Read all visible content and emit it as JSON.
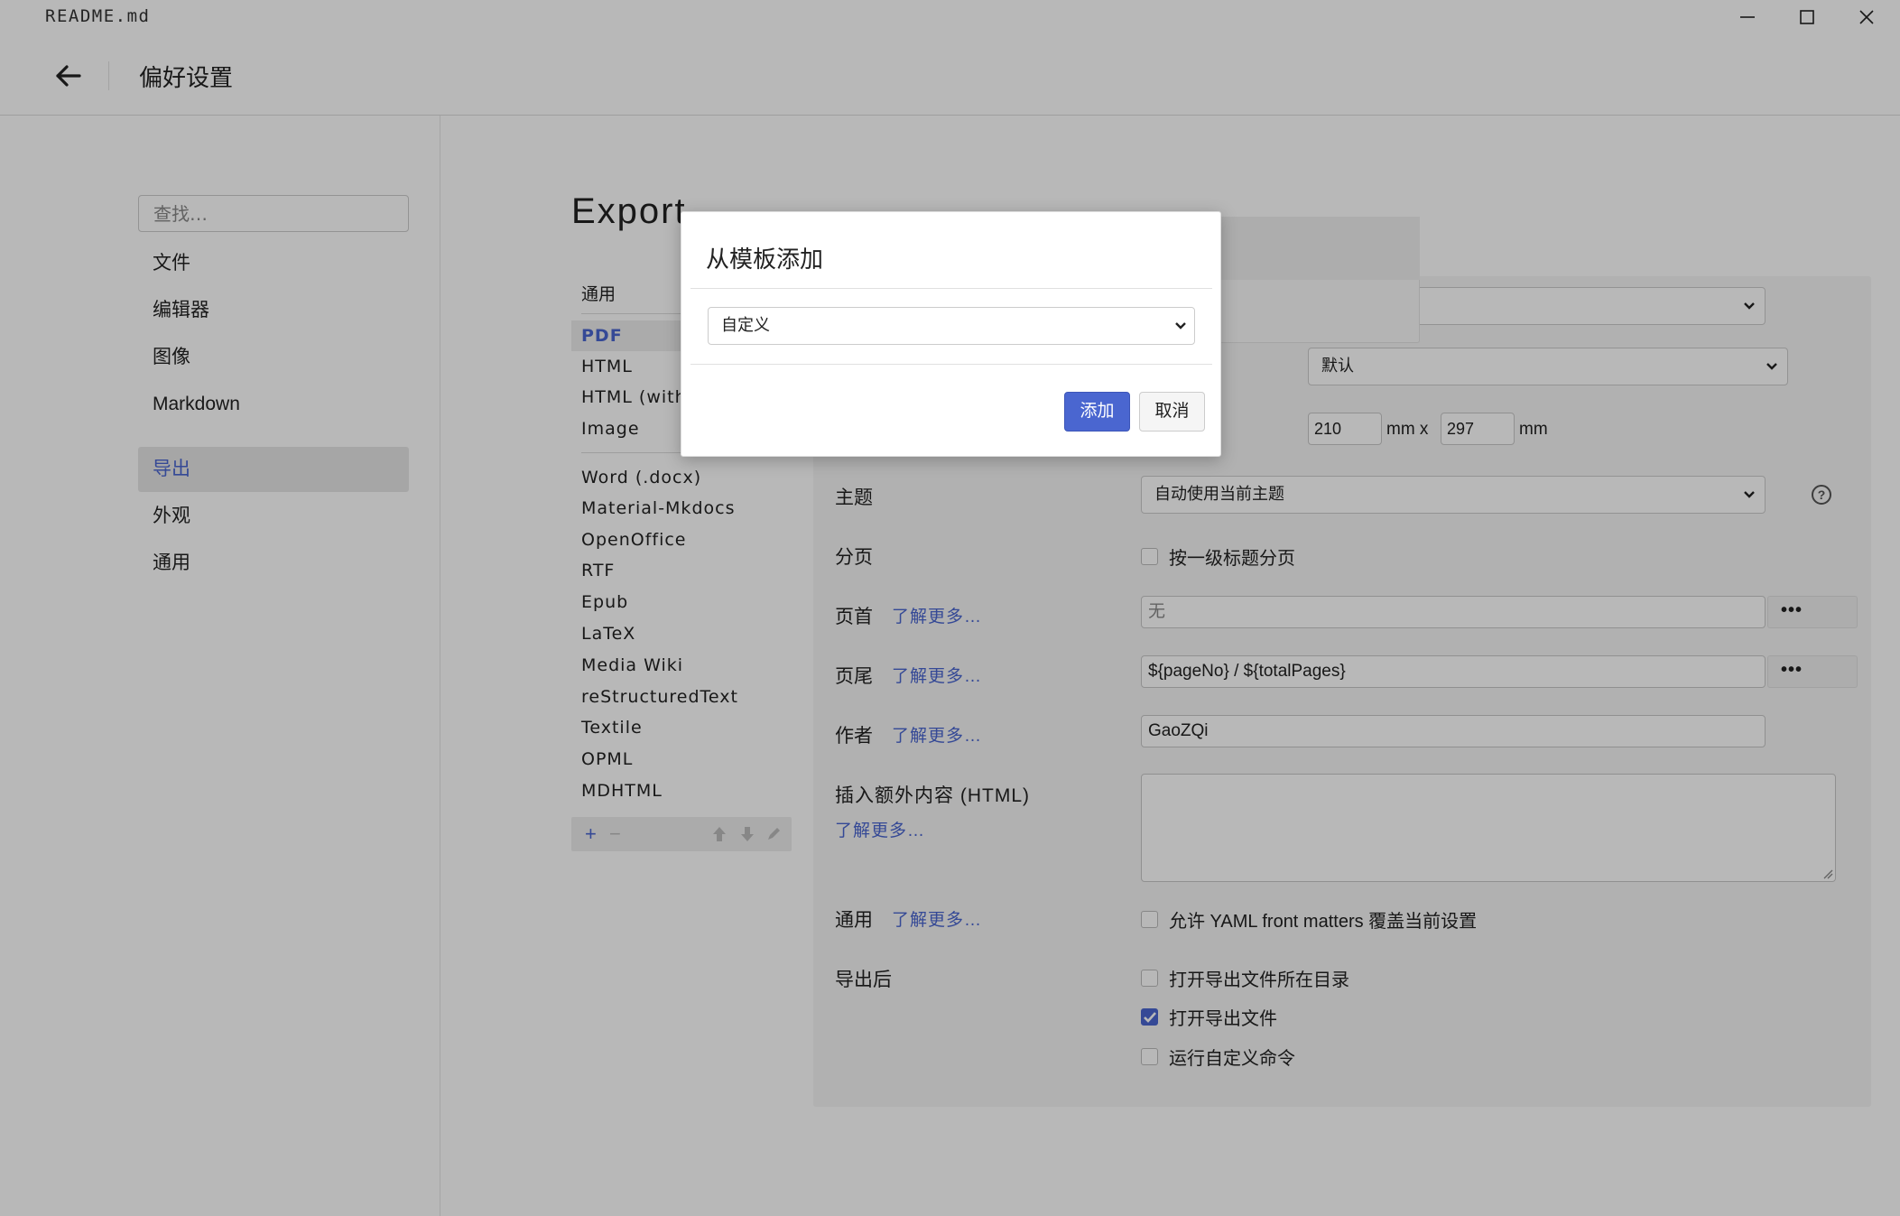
{
  "window": {
    "filename": "README.md"
  },
  "header": {
    "title": "偏好设置"
  },
  "sidebar": {
    "search_placeholder": "查找…",
    "items": [
      {
        "label": "文件"
      },
      {
        "label": "编辑器"
      },
      {
        "label": "图像"
      },
      {
        "label": "Markdown"
      },
      {
        "label": "导出",
        "active": true
      },
      {
        "label": "外观"
      },
      {
        "label": "通用"
      }
    ]
  },
  "export": {
    "title": "Export",
    "list_header": "通用",
    "formats_group1": [
      {
        "label": "PDF",
        "active": true
      },
      {
        "label": "HTML"
      },
      {
        "label": "HTML (witho"
      },
      {
        "label": "Image"
      }
    ],
    "formats_group2": [
      {
        "label": "Word (.docx)"
      },
      {
        "label": "Material-Mkdocs"
      },
      {
        "label": "OpenOffice"
      },
      {
        "label": "RTF"
      },
      {
        "label": "Epub"
      },
      {
        "label": "LaTeX"
      },
      {
        "label": "Media Wiki"
      },
      {
        "label": "reStructuredText"
      },
      {
        "label": "Textile"
      },
      {
        "label": "OPML"
      },
      {
        "label": "MDHTML"
      }
    ],
    "toolbar": {
      "add": "+",
      "remove": "−"
    }
  },
  "settings": {
    "page_size_select": "默认",
    "width_value": "210",
    "height_value": "297",
    "unit_mm": "mm",
    "unit_x": "mm x",
    "theme_label": "主题",
    "theme_value": "自动使用当前主题",
    "pagination_label": "分页",
    "pagination_checkbox": "按一级标题分页",
    "header_label": "页首",
    "header_link": "了解更多…",
    "header_placeholder": "无",
    "footer_label": "页尾",
    "footer_link": "了解更多…",
    "footer_value": "${pageNo} / ${totalPages}",
    "author_label": "作者",
    "author_link": "了解更多…",
    "author_value": "GaoZQi",
    "extra_label": "插入额外内容 (HTML)",
    "extra_link": "了解更多…",
    "general_label": "通用",
    "general_link": "了解更多…",
    "yaml_checkbox": "允许 YAML front matters 覆盖当前设置",
    "after_export_label": "导出后",
    "after_options": [
      {
        "label": "打开导出文件所在目录",
        "checked": false
      },
      {
        "label": "打开导出文件",
        "checked": true
      },
      {
        "label": "运行自定义命令",
        "checked": false
      }
    ],
    "more_button": "•••"
  },
  "modal": {
    "title": "从模板添加",
    "select_value": "自定义",
    "confirm_label": "添加",
    "cancel_label": "取消"
  },
  "colors": {
    "accent": "#4a66d0"
  }
}
